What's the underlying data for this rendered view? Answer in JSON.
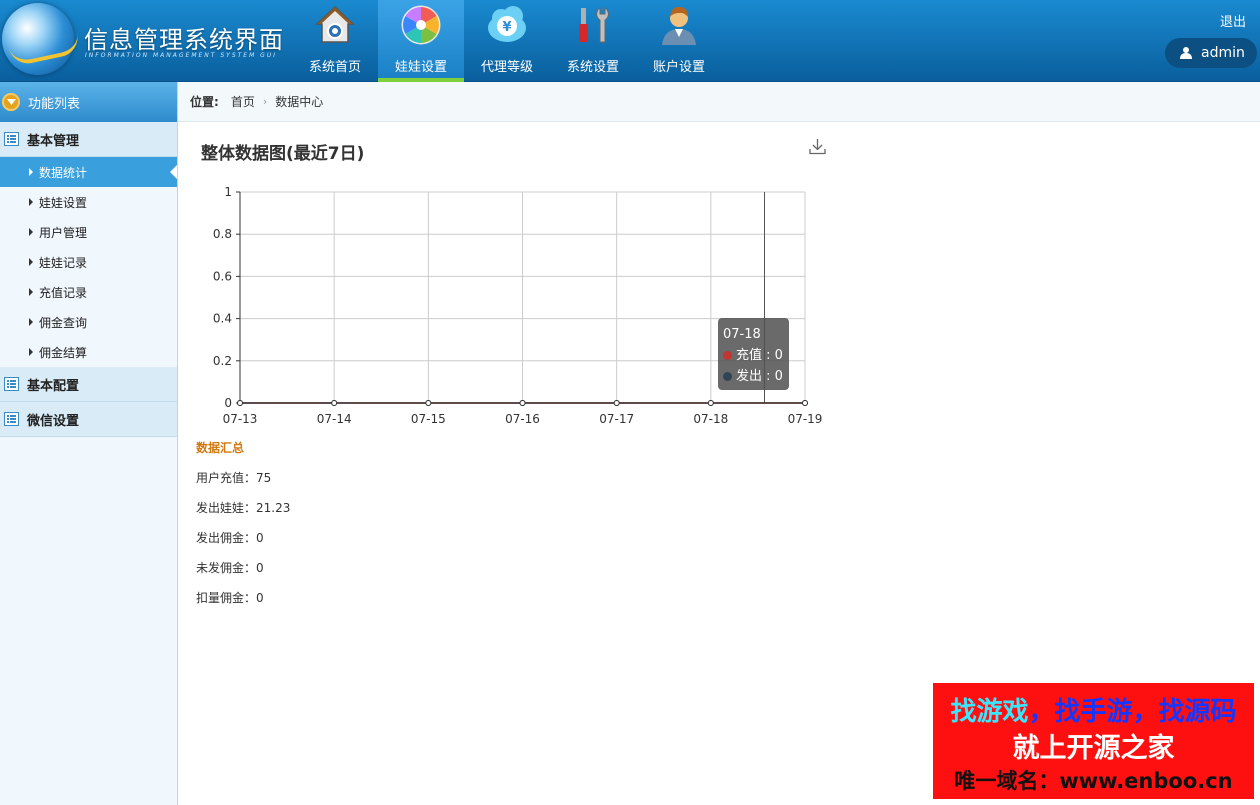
{
  "header": {
    "title": "信息管理系统界面",
    "subtitle": "INFORMATION MANAGEMENT SYSTEM GUI",
    "nav": [
      {
        "label": "系统首页",
        "icon": "home-icon"
      },
      {
        "label": "娃娃设置",
        "icon": "color-wheel-icon"
      },
      {
        "label": "代理等级",
        "icon": "yen-cloud-icon"
      },
      {
        "label": "系统设置",
        "icon": "tools-icon"
      },
      {
        "label": "账户设置",
        "icon": "user-account-icon"
      }
    ],
    "active_nav": "娃娃设置",
    "logout": "退出",
    "username": "admin"
  },
  "sidebar": {
    "title": "功能列表",
    "groups": [
      {
        "label": "基本管理"
      },
      {
        "label": "基本配置"
      },
      {
        "label": "微信设置"
      }
    ],
    "items": [
      {
        "label": "数据统计"
      },
      {
        "label": "娃娃设置"
      },
      {
        "label": "用户管理"
      },
      {
        "label": "娃娃记录"
      },
      {
        "label": "充值记录"
      },
      {
        "label": "佣金查询"
      },
      {
        "label": "佣金结算"
      }
    ],
    "active_item": "数据统计"
  },
  "breadcrumb": {
    "label": "位置:",
    "items": [
      "首页",
      "数据中心"
    ]
  },
  "chart_data": {
    "type": "line",
    "title": "整体数据图(最近7日)",
    "x": [
      "07-13",
      "07-14",
      "07-15",
      "07-16",
      "07-17",
      "07-18",
      "07-19"
    ],
    "series": [
      {
        "name": "充值",
        "values": [
          0,
          0,
          0,
          0,
          0,
          0,
          0
        ],
        "color": "#c23531"
      },
      {
        "name": "发出",
        "values": [
          0,
          0,
          0,
          0,
          0,
          0,
          0
        ],
        "color": "#2f4554"
      }
    ],
    "ylim": [
      0,
      1
    ],
    "yticks": [
      0,
      0.2,
      0.4,
      0.6,
      0.8,
      1
    ],
    "yticklabels": [
      "0",
      "0.2",
      "0.4",
      "0.6",
      "0.8",
      "1"
    ],
    "grid": true,
    "tooltip": {
      "x": "07-18",
      "rows": [
        "充值 : 0",
        "发出 : 0"
      ]
    }
  },
  "summary": {
    "title": "数据汇总",
    "rows": [
      {
        "text": "用户充值：75"
      },
      {
        "text": "发出娃娃：21.23"
      },
      {
        "text": "发出佣金：0"
      },
      {
        "text": "未发佣金：0"
      },
      {
        "text": "扣量佣金：0"
      }
    ]
  },
  "watermark": {
    "line1_a": "找游戏",
    "line1_b": "，找手游，找源码",
    "line2": "就上开源之家",
    "line3": "唯一域名：www.enboo.cn"
  }
}
